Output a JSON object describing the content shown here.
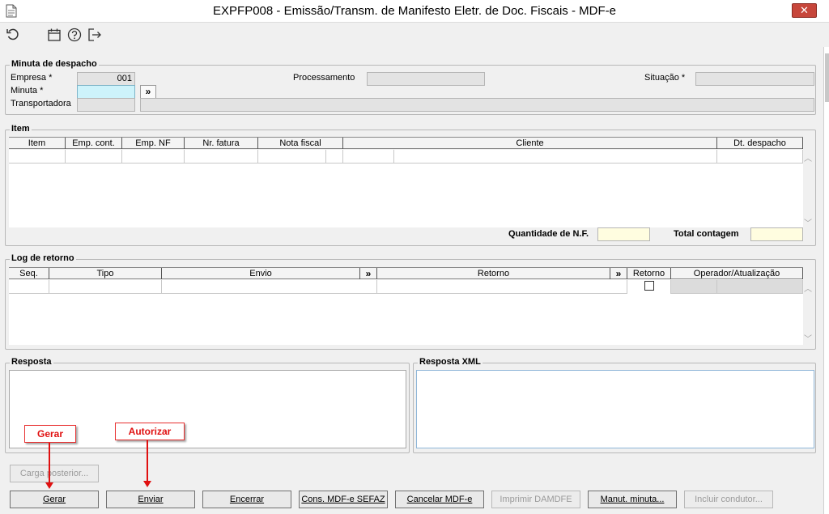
{
  "window": {
    "title": "EXPFP008 - Emissão/Transm. de Manifesto Eletr. de Doc. Fiscais - MDF-e",
    "close_label": "✕"
  },
  "toolbar": {
    "icons": [
      "refresh-icon",
      "calendar-icon",
      "help-icon",
      "exit-icon"
    ]
  },
  "minuta": {
    "group_label": "Minuta de despacho",
    "empresa_label": "Empresa *",
    "empresa_value": "001",
    "minuta_label": "Minuta *",
    "minuta_value": "",
    "transportadora_label": "Transportadora",
    "processamento_label": "Processamento",
    "situacao_label": "Situação *",
    "lookup_label": "»"
  },
  "item": {
    "group_label": "Item",
    "columns": [
      "Item",
      "Emp. cont.",
      "Emp. NF",
      "Nr. fatura",
      "Nota fiscal",
      "Cliente",
      "Dt. despacho"
    ],
    "qtd_nf_label": "Quantidade de N.F.",
    "total_contagem_label": "Total contagem"
  },
  "log": {
    "group_label": "Log de retorno",
    "columns": [
      "Seq.",
      "Tipo",
      "Envio",
      "»",
      "Retorno",
      "»",
      "Retorno",
      "Operador/Atualização"
    ]
  },
  "resposta": {
    "group_label": "Resposta"
  },
  "resposta_xml": {
    "group_label": "Resposta XML"
  },
  "buttons": {
    "carga_posterior": "Carga posterior...",
    "gerar": "Gerar",
    "enviar": "Enviar",
    "encerrar": "Encerrar",
    "cons_mdfe": "Cons. MDF-e SEFAZ",
    "cancelar_mdfe": "Cancelar MDF-e",
    "imprimir_damdfe": "Imprimir DAMDFE",
    "manut_minuta": "Manut. minuta...",
    "incluir_condutor": "Incluir condutor..."
  },
  "callouts": {
    "gerar": "Gerar",
    "autorizar": "Autorizar"
  },
  "colors": {
    "callout_red": "#e01010",
    "close_red": "#c7463b",
    "required_field": "#cdf3fb",
    "total_field": "#fffde0"
  }
}
